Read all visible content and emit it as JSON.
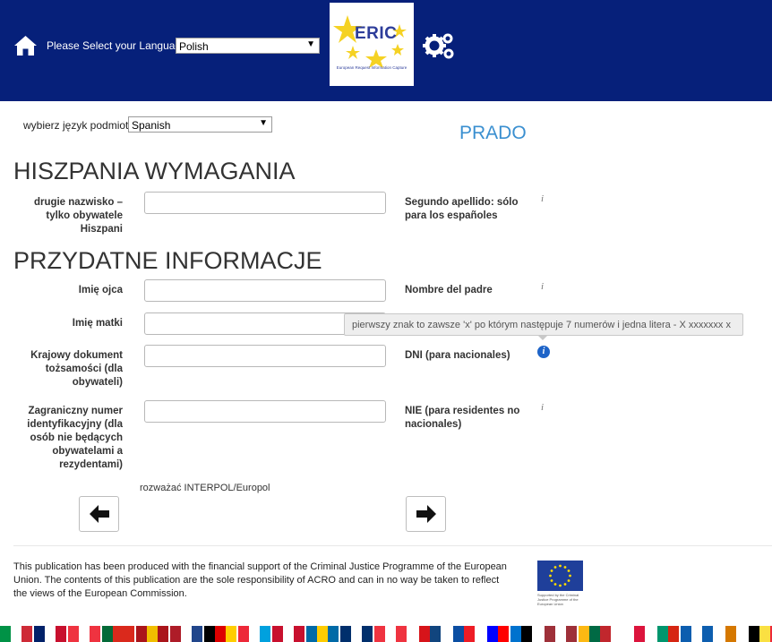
{
  "header": {
    "language_prompt": "Please Select your Language",
    "language_selected": "Polish",
    "logo_title": "ERIC",
    "logo_subtitle": "European Request Information Capture"
  },
  "subject": {
    "label": "wybierz język podmiotu",
    "selected": "Spanish",
    "prado_link": "PRADO"
  },
  "section_requirements": {
    "title": "HISZPANIA WYMAGANIA",
    "fields": [
      {
        "label": "drugie nazwisko – tylko obywatele Hiszpani",
        "spanish": "Segundo apellido: sólo para los españoles",
        "value": ""
      }
    ]
  },
  "section_useful": {
    "title": "PRZYDATNE INFORMACJE",
    "fields": [
      {
        "label": "Imię ojca",
        "spanish": "Nombre del padre",
        "value": ""
      },
      {
        "label": "Imię matki",
        "spanish": "",
        "value": ""
      },
      {
        "label": "Krajowy dokument tożsamości (dla obywateli)",
        "spanish": "DNI (para nacionales)",
        "value": ""
      },
      {
        "label": "Zagraniczny numer identyfikacyjny (dla osób nie będących obywatelami a rezydentami)",
        "spanish": "NIE (para residentes no nacionales)",
        "value": ""
      }
    ]
  },
  "tooltip": "pierwszy znak to zawsze 'x' po którym następuje 7 numerów i jedna litera - X xxxxxxx x",
  "info_glyph": "i",
  "interpol_note": "rozważać INTERPOL/Europol",
  "footer": {
    "disclaimer": "This publication has been produced with the financial support of the Criminal Justice Programme of the European Union. The contents of this publication are the sole responsibility of ACRO and can in no way be taken to reflect the views of the European Commission.",
    "eu_caption": "Supported by the Criminal Justice Programme of the European Union"
  },
  "colors": {
    "header_bg": "#06207a",
    "link_blue": "#3a8fd0",
    "info_active": "#1e64c8"
  },
  "flags": [
    [
      "#009246",
      "#ffffff",
      "#ce2b37"
    ],
    [
      "#012169",
      "#ffffff",
      "#c8102e"
    ],
    [
      "#ef3340",
      "#ffffff",
      "#ef3340"
    ],
    [
      "#046a38",
      "#da291c",
      "#da291c"
    ],
    [
      "#aa151b",
      "#f1bf00",
      "#aa151b"
    ],
    [
      "#ae1c28",
      "#ffffff",
      "#21468b"
    ],
    [
      "#000000",
      "#dd0000",
      "#ffce00"
    ],
    [
      "#ed2939",
      "#ffffff",
      "#00a1de"
    ],
    [
      "#c8102e",
      "#ffffff",
      "#c8102e"
    ],
    [
      "#006aa7",
      "#fecc00",
      "#006aa7"
    ],
    [
      "#002f6c",
      "#ffffff",
      "#002f6c"
    ],
    [
      "#ef3340",
      "#ffffff",
      "#ef3340"
    ],
    [
      "#ffffff",
      "#d7141a",
      "#11457e"
    ],
    [
      "#ffffff",
      "#0b4ea2",
      "#ee1c25"
    ],
    [
      "#ffffff",
      "#0000ff",
      "#ff0000"
    ],
    [
      "#0072ce",
      "#000000",
      "#ffffff"
    ],
    [
      "#9e3039",
      "#ffffff",
      "#9e3039"
    ],
    [
      "#fdb913",
      "#006a44",
      "#c1272d"
    ],
    [
      "#ffffff",
      "#ffffff",
      "#dc143c"
    ],
    [
      "#ffffff",
      "#00966e",
      "#d62612"
    ],
    [
      "#0d5eaf",
      "#ffffff",
      "#0d5eaf"
    ],
    [
      "#ffffff",
      "#d57800",
      "#ffffff"
    ],
    [
      "#000000",
      "#fae042",
      "#ed2939"
    ],
    [
      "#ff0000",
      "#ffffff",
      "#171796"
    ],
    [
      "#ffffff",
      "#dc143c",
      "#dc143c"
    ]
  ]
}
